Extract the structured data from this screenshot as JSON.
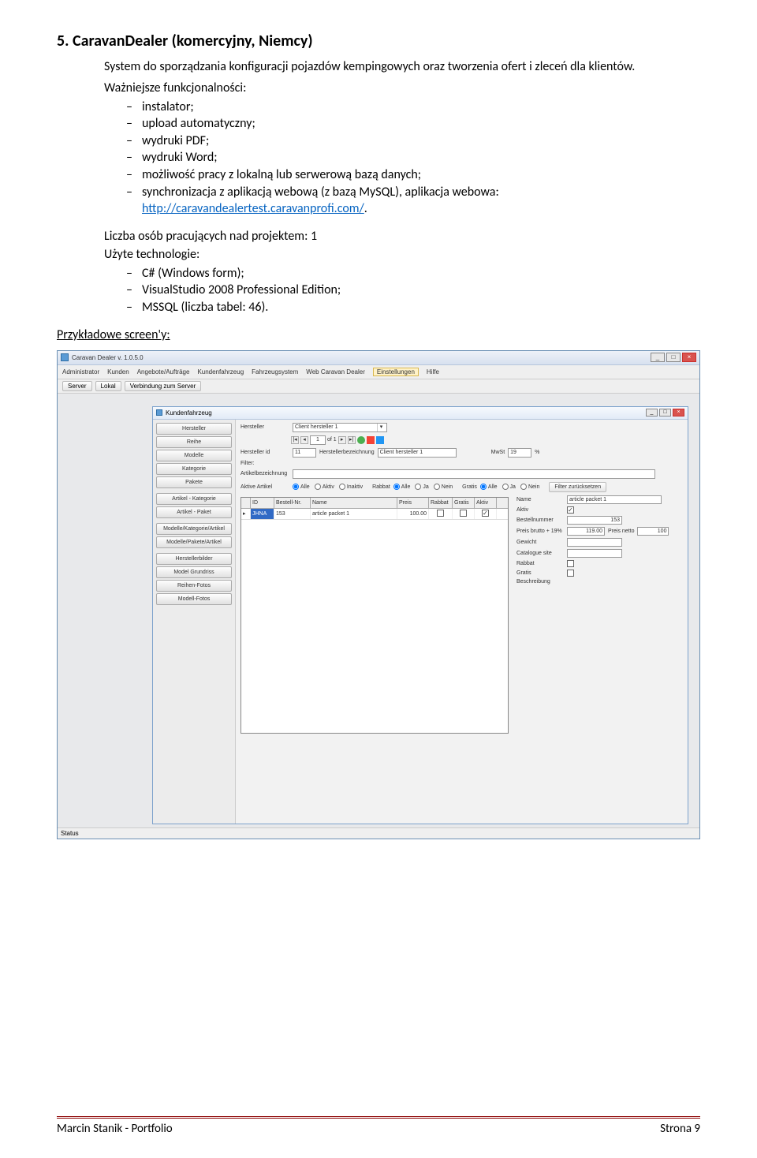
{
  "doc": {
    "section_title": "5. CaravanDealer (komercyjny, Niemcy)",
    "intro": "System do sporządzania konfiguracji pojazdów kempingowych oraz tworzenia ofert i zleceń dla klientów.",
    "features_heading": "Ważniejsze funkcjonalności:",
    "features": [
      "instalator;",
      "upload automatyczny;",
      "wydruki PDF;",
      "wydruki Word;",
      "możliwość pracy z lokalną lub serwerową bazą danych;",
      "synchronizacja z aplikacją webową (z bazą MySQL), aplikacja webowa: "
    ],
    "link_text": "http://caravandealertest.caravanprofi.com/",
    "link_suffix": ".",
    "team_line": "Liczba osób pracujących nad projektem: 1",
    "tech_heading": "Użyte technologie:",
    "tech": [
      "C# (Windows form);",
      "VisualStudio 2008 Professional Edition;",
      "MSSQL (liczba tabel: 46)."
    ],
    "screens_label": "Przykładowe screen'y:"
  },
  "app": {
    "title": "Caravan Dealer v. 1.0.5.0",
    "menus": [
      "Administrator",
      "Kunden",
      "Angebote/Aufträge",
      "Kundenfahrzeug",
      "Fahrzeugsystem",
      "Web Caravan Dealer",
      "Einstellungen",
      "Hilfe"
    ],
    "menu_active_index": 6,
    "toolbar": {
      "server": "Server",
      "lokal": "Lokal",
      "conn": "Verbindung zum Server"
    },
    "status": "Status",
    "child": {
      "title": "Kundenfahrzeug",
      "sidebar": [
        "Hersteller",
        "Reihe",
        "Modelle",
        "Kategorie",
        "Pakete",
        "Artikel - Kategorie",
        "Artikel - Paket",
        "Modelle/Kategorie/Artikel",
        "Modelle/Pakete/Artikel",
        "Herstellerbilder",
        "Model Grundriss",
        "Reihen-Fotos",
        "Modell-Fotos"
      ],
      "form": {
        "hersteller_label": "Hersteller",
        "hersteller_value": "Client hersteller 1",
        "nav_of": "of 1",
        "nav_pos": "1",
        "hersteller_id_label": "Hersteller id",
        "hersteller_id_value": "11",
        "hersteller_bez_label": "Herstellerbezeichnung",
        "hersteller_bez_value": "Client hersteller 1",
        "mwst_label": "MwSt",
        "mwst_value": "19",
        "mwst_unit": "%",
        "filter_label": "Filter:",
        "artikel_bez_label": "Artikelbezeichnung",
        "aktive_artikel_label": "Aktive Artikel",
        "alle": "Alle",
        "aktiv": "Aktiv",
        "inaktiv": "Inaktiv",
        "rabbat_label": "Rabbat",
        "ja": "Ja",
        "nein": "Nein",
        "gratis_label": "Gratis",
        "filter_reset": "Filter zurücksetzen"
      },
      "grid": {
        "headers": [
          "ID",
          "Bestell-Nr.",
          "Name",
          "Preis",
          "Rabbat",
          "Gratis",
          "Aktiv"
        ],
        "row": {
          "id": "JHNA",
          "bestell": "153",
          "name": "article packet 1",
          "preis": "100.00"
        }
      },
      "details": {
        "name_label": "Name",
        "name_value": "article packet 1",
        "aktiv_label": "Aktiv",
        "bestell_label": "Bestellnummer",
        "bestell_value": "153",
        "brutto_label": "Preis brutto + 19%",
        "brutto_value": "119.00",
        "netto_label": "Preis netto",
        "netto_value": "100",
        "gewicht_label": "Gewicht",
        "catalogue_label": "Catalogue site",
        "rabbat_label": "Rabbat",
        "gratis_label": "Gratis",
        "beschreibung_label": "Beschreibung"
      }
    }
  },
  "footer": {
    "left": "Marcin Stanik - Portfolio",
    "right": "Strona 9"
  }
}
